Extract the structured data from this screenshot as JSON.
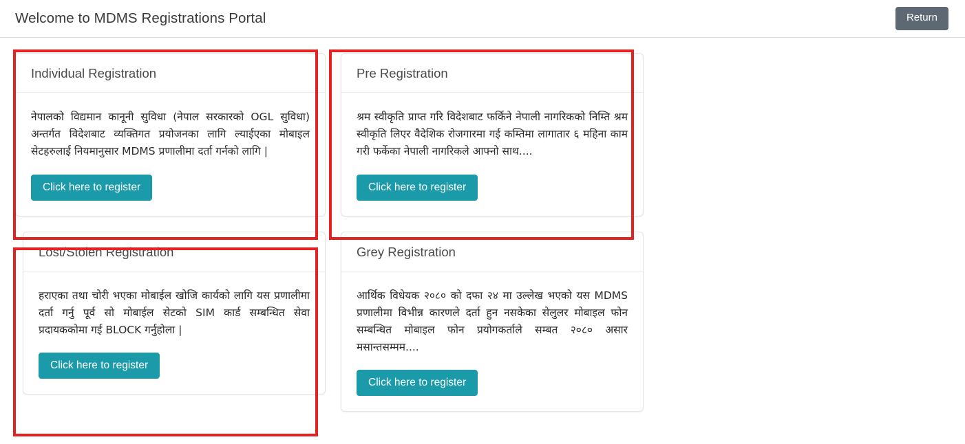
{
  "header": {
    "title": "Welcome to MDMS Registrations Portal",
    "return_label": "Return"
  },
  "colors": {
    "accent_button": "#1b9aaa",
    "return_button": "#5d6873",
    "annotation_border": "#e52222",
    "card_border": "#e4e4e4",
    "text": "#2b2b2b"
  },
  "cards": [
    {
      "title": "Individual Registration",
      "description": "नेपालको विद्यमान कानूनी सुविधा (नेपाल सरकारको OGL सुविधा) अन्तर्गत विदेशबाट व्यक्तिगत प्रयोजनका लागि ल्याईएका मोबाइल सेटहरुलाई नियमानुसार MDMS प्रणालीमा दर्ता गर्नको लागि |",
      "button_label": "Click here to register",
      "highlighted": true
    },
    {
      "title": "Pre Registration",
      "description": "श्रम स्वीकृति प्राप्त गरि विदेशबाट फर्किने नेपाली नागरिकको निम्ति श्रम स्वीकृति लिएर वैदेशिक रोजगारमा गई कम्तिमा लागातार ६ महिना काम गरी फर्केका नेपाली नागरिकले आफ्नो साथ....",
      "button_label": "Click here to register",
      "highlighted": true
    },
    {
      "title": "Lost/Stolen Registration",
      "description": "हराएका तथा चोरी भएका मोबाईल खोजि कार्यको लागि यस प्रणालीमा दर्ता गर्नु पूर्व सो मोबाईल सेटको SIM कार्ड सम्बन्धित सेवा प्रदायककोमा गई BLOCK गर्नुहोला |",
      "button_label": "Click here to register",
      "highlighted": false
    },
    {
      "title": "Grey Registration",
      "description": "आर्थिक विधेयक २०८० को दफा २४ मा उल्लेख भएको यस MDMS प्रणालीमा विभीन्न कारणले दर्ता हुन नसकेका सेलुलर मोबाइल फोन सम्बन्धित मोबाइल फोन प्रयोगकर्ताले सम्बत २०८० असार मसान्तसम्मम....",
      "button_label": "Click here to register",
      "highlighted": true
    }
  ]
}
